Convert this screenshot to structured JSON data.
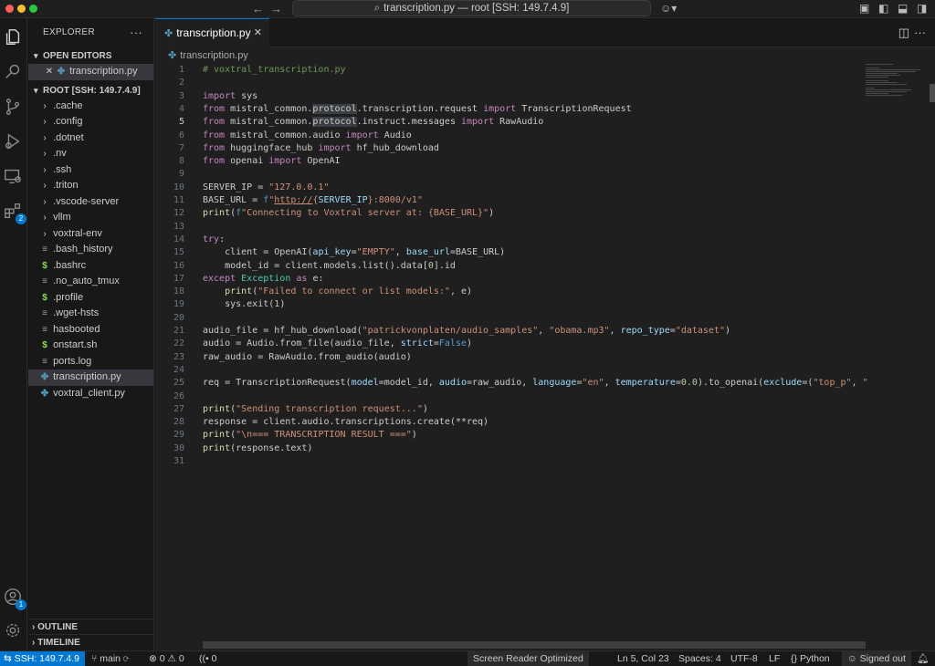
{
  "titlebar": {
    "command_center": "transcription.py — root [SSH: 149.7.4.9]"
  },
  "activity": {
    "extensions_badge": "2",
    "accounts_badge": "1"
  },
  "sidebar": {
    "title": "EXPLORER",
    "open_editors_title": "OPEN EDITORS",
    "open_editors": [
      {
        "label": "transcription.py"
      }
    ],
    "root_title": "ROOT [SSH: 149.7.4.9]",
    "folders": [
      {
        "label": ".cache"
      },
      {
        "label": ".config"
      },
      {
        "label": ".dotnet"
      },
      {
        "label": ".nv"
      },
      {
        "label": ".ssh"
      },
      {
        "label": ".triton"
      },
      {
        "label": ".vscode-server"
      },
      {
        "label": "vllm"
      },
      {
        "label": "voxtral-env"
      }
    ],
    "files": [
      {
        "label": ".bash_history",
        "icon": "≡"
      },
      {
        "label": ".bashrc",
        "icon": "$"
      },
      {
        "label": ".no_auto_tmux",
        "icon": "≡"
      },
      {
        "label": ".profile",
        "icon": "$"
      },
      {
        "label": ".wget-hsts",
        "icon": "≡"
      },
      {
        "label": "hasbooted",
        "icon": "≡"
      },
      {
        "label": "onstart.sh",
        "icon": "$"
      },
      {
        "label": "ports.log",
        "icon": "≡"
      },
      {
        "label": "transcription.py",
        "icon": "✤"
      },
      {
        "label": "voxtral_client.py",
        "icon": "✤"
      }
    ],
    "outline_title": "OUTLINE",
    "timeline_title": "TIMELINE"
  },
  "editor": {
    "tab_label": "transcription.py",
    "breadcrumb": "transcription.py",
    "current_line": 5
  },
  "statusbar": {
    "remote": "SSH: 149.7.4.9",
    "branch": "main",
    "errors": "0",
    "warnings": "0",
    "ports": "0",
    "screen_reader": "Screen Reader Optimized",
    "position": "Ln 5, Col 23",
    "spaces": "Spaces: 4",
    "encoding": "UTF-8",
    "eol": "LF",
    "language": "Python",
    "account": "Signed out"
  }
}
